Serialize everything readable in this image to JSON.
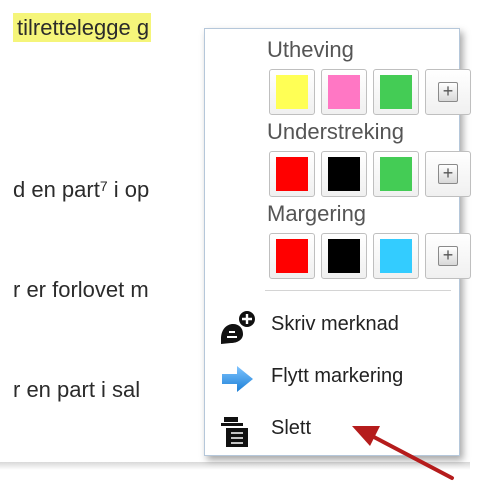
{
  "document": {
    "line1": "tilrettelegge ",
    "line1_tail": "g",
    "line2_a": "d en part",
    "line2_sup": "7",
    "line2_b": " i op",
    "line3": "r er forlovet m",
    "line4": "r en part i sal"
  },
  "menu": {
    "highlight": {
      "label": "Utheving",
      "colors": [
        "#ffff55",
        "#ff77c4",
        "#44cc55"
      ]
    },
    "underline": {
      "label": "Understreking",
      "colors": [
        "#ff0000",
        "#000000",
        "#44cc55"
      ]
    },
    "margin": {
      "label": "Margering",
      "colors": [
        "#ff0000",
        "#000000",
        "#33ccff"
      ]
    },
    "add_symbol": "+",
    "items": [
      {
        "label": "Skriv merknad",
        "icon": "comment-add-icon"
      },
      {
        "label": "Flytt markering",
        "icon": "arrow-right-icon"
      },
      {
        "label": "Slett",
        "icon": "delete-icon"
      }
    ]
  },
  "annotation": {
    "arrow_color": "#b51c1c"
  }
}
